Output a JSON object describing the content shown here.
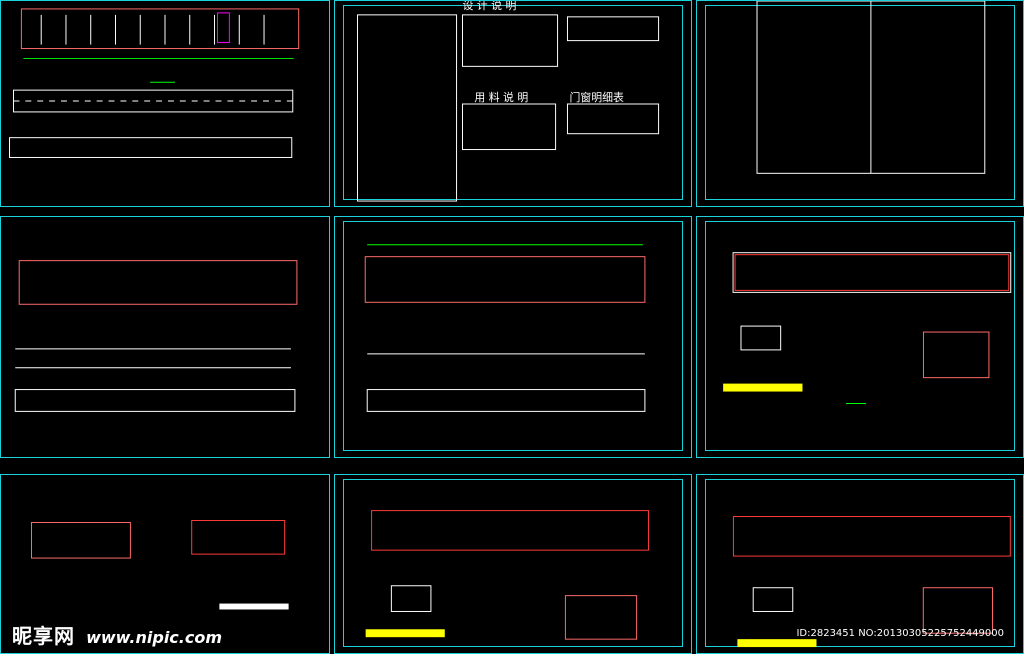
{
  "title_design_notes": "设 计 说 明",
  "title_materials": "用 料 说 明",
  "title_door_window": "门窗明细表",
  "watermark_logo": "昵享网",
  "watermark_url": "www.nipic.com",
  "image_id": "ID:2823451 NO:20130305225752449000",
  "colors": {
    "frame": "#19d2dc",
    "line": "#ffffff",
    "wall": "#ff3b3b",
    "dim": "#00ff00",
    "accent": "#ff00ff",
    "yellow": "#ffff00"
  }
}
